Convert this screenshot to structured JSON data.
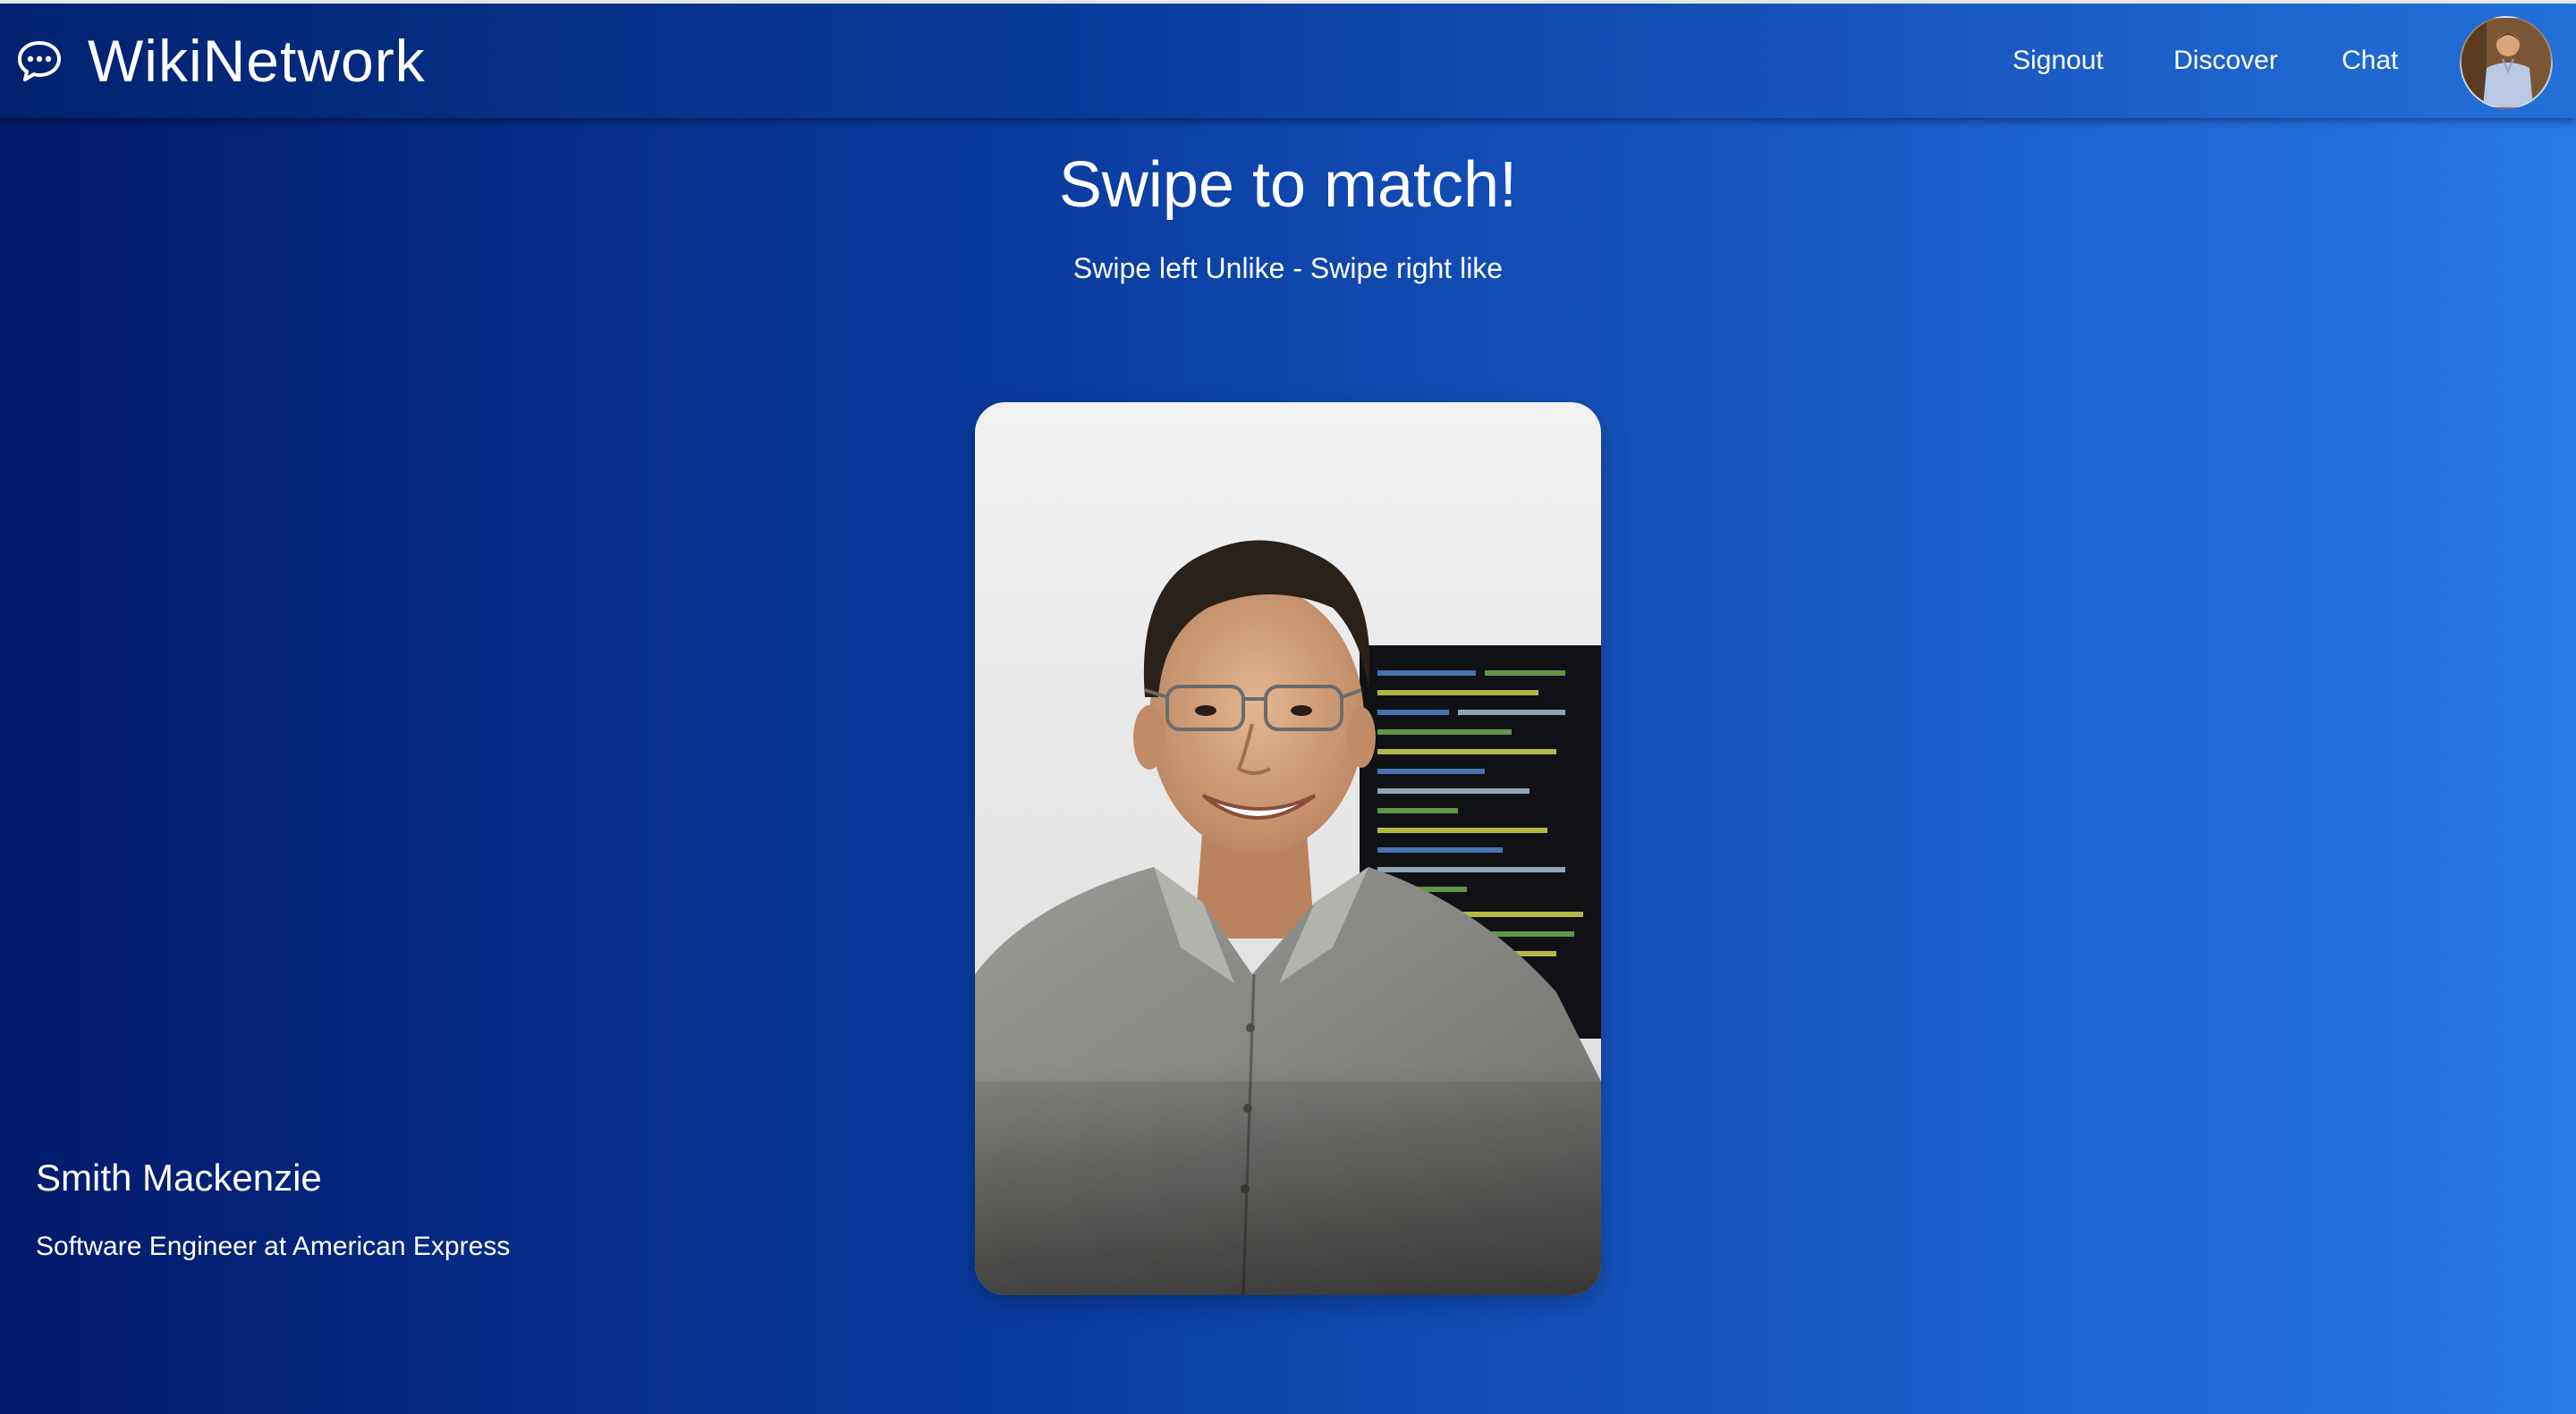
{
  "brand": {
    "icon": "chat-bubble-icon",
    "title": "WikiNetwork"
  },
  "nav": {
    "signout": "Signout",
    "discover": "Discover",
    "chat": "Chat",
    "avatar_icon": "user-avatar"
  },
  "main": {
    "title": "Swipe to match!",
    "subtitle": "Swipe left Unlike - Swipe right like"
  },
  "card": {
    "name": "Smith Mackenzie",
    "role": "Software Engineer at American Express"
  },
  "colors": {
    "gradient_start": "#021a6b",
    "gradient_end": "#2879e6",
    "text": "#ffffff"
  }
}
